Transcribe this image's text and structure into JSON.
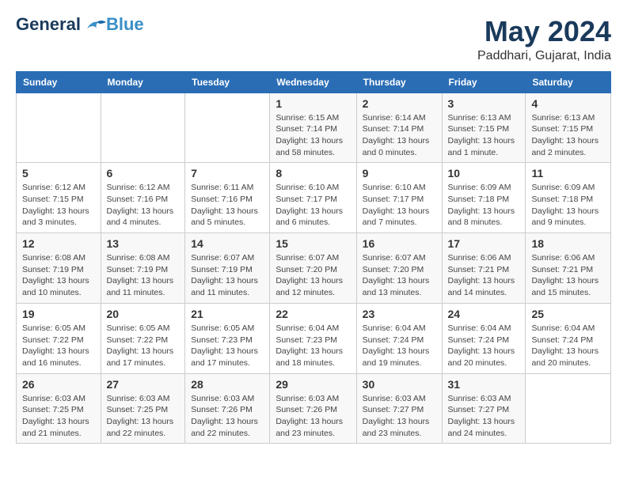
{
  "logo": {
    "text_general": "General",
    "text_blue": "Blue"
  },
  "title": {
    "month_year": "May 2024",
    "location": "Paddhari, Gujarat, India"
  },
  "days_header": [
    "Sunday",
    "Monday",
    "Tuesday",
    "Wednesday",
    "Thursday",
    "Friday",
    "Saturday"
  ],
  "weeks": [
    [
      {
        "num": "",
        "info": ""
      },
      {
        "num": "",
        "info": ""
      },
      {
        "num": "",
        "info": ""
      },
      {
        "num": "1",
        "info": "Sunrise: 6:15 AM\nSunset: 7:14 PM\nDaylight: 13 hours and 58 minutes."
      },
      {
        "num": "2",
        "info": "Sunrise: 6:14 AM\nSunset: 7:14 PM\nDaylight: 13 hours and 0 minutes."
      },
      {
        "num": "3",
        "info": "Sunrise: 6:13 AM\nSunset: 7:15 PM\nDaylight: 13 hours and 1 minute."
      },
      {
        "num": "4",
        "info": "Sunrise: 6:13 AM\nSunset: 7:15 PM\nDaylight: 13 hours and 2 minutes."
      }
    ],
    [
      {
        "num": "5",
        "info": "Sunrise: 6:12 AM\nSunset: 7:15 PM\nDaylight: 13 hours and 3 minutes."
      },
      {
        "num": "6",
        "info": "Sunrise: 6:12 AM\nSunset: 7:16 PM\nDaylight: 13 hours and 4 minutes."
      },
      {
        "num": "7",
        "info": "Sunrise: 6:11 AM\nSunset: 7:16 PM\nDaylight: 13 hours and 5 minutes."
      },
      {
        "num": "8",
        "info": "Sunrise: 6:10 AM\nSunset: 7:17 PM\nDaylight: 13 hours and 6 minutes."
      },
      {
        "num": "9",
        "info": "Sunrise: 6:10 AM\nSunset: 7:17 PM\nDaylight: 13 hours and 7 minutes."
      },
      {
        "num": "10",
        "info": "Sunrise: 6:09 AM\nSunset: 7:18 PM\nDaylight: 13 hours and 8 minutes."
      },
      {
        "num": "11",
        "info": "Sunrise: 6:09 AM\nSunset: 7:18 PM\nDaylight: 13 hours and 9 minutes."
      }
    ],
    [
      {
        "num": "12",
        "info": "Sunrise: 6:08 AM\nSunset: 7:19 PM\nDaylight: 13 hours and 10 minutes."
      },
      {
        "num": "13",
        "info": "Sunrise: 6:08 AM\nSunset: 7:19 PM\nDaylight: 13 hours and 11 minutes."
      },
      {
        "num": "14",
        "info": "Sunrise: 6:07 AM\nSunset: 7:19 PM\nDaylight: 13 hours and 11 minutes."
      },
      {
        "num": "15",
        "info": "Sunrise: 6:07 AM\nSunset: 7:20 PM\nDaylight: 13 hours and 12 minutes."
      },
      {
        "num": "16",
        "info": "Sunrise: 6:07 AM\nSunset: 7:20 PM\nDaylight: 13 hours and 13 minutes."
      },
      {
        "num": "17",
        "info": "Sunrise: 6:06 AM\nSunset: 7:21 PM\nDaylight: 13 hours and 14 minutes."
      },
      {
        "num": "18",
        "info": "Sunrise: 6:06 AM\nSunset: 7:21 PM\nDaylight: 13 hours and 15 minutes."
      }
    ],
    [
      {
        "num": "19",
        "info": "Sunrise: 6:05 AM\nSunset: 7:22 PM\nDaylight: 13 hours and 16 minutes."
      },
      {
        "num": "20",
        "info": "Sunrise: 6:05 AM\nSunset: 7:22 PM\nDaylight: 13 hours and 17 minutes."
      },
      {
        "num": "21",
        "info": "Sunrise: 6:05 AM\nSunset: 7:23 PM\nDaylight: 13 hours and 17 minutes."
      },
      {
        "num": "22",
        "info": "Sunrise: 6:04 AM\nSunset: 7:23 PM\nDaylight: 13 hours and 18 minutes."
      },
      {
        "num": "23",
        "info": "Sunrise: 6:04 AM\nSunset: 7:24 PM\nDaylight: 13 hours and 19 minutes."
      },
      {
        "num": "24",
        "info": "Sunrise: 6:04 AM\nSunset: 7:24 PM\nDaylight: 13 hours and 20 minutes."
      },
      {
        "num": "25",
        "info": "Sunrise: 6:04 AM\nSunset: 7:24 PM\nDaylight: 13 hours and 20 minutes."
      }
    ],
    [
      {
        "num": "26",
        "info": "Sunrise: 6:03 AM\nSunset: 7:25 PM\nDaylight: 13 hours and 21 minutes."
      },
      {
        "num": "27",
        "info": "Sunrise: 6:03 AM\nSunset: 7:25 PM\nDaylight: 13 hours and 22 minutes."
      },
      {
        "num": "28",
        "info": "Sunrise: 6:03 AM\nSunset: 7:26 PM\nDaylight: 13 hours and 22 minutes."
      },
      {
        "num": "29",
        "info": "Sunrise: 6:03 AM\nSunset: 7:26 PM\nDaylight: 13 hours and 23 minutes."
      },
      {
        "num": "30",
        "info": "Sunrise: 6:03 AM\nSunset: 7:27 PM\nDaylight: 13 hours and 23 minutes."
      },
      {
        "num": "31",
        "info": "Sunrise: 6:03 AM\nSunset: 7:27 PM\nDaylight: 13 hours and 24 minutes."
      },
      {
        "num": "",
        "info": ""
      }
    ]
  ]
}
